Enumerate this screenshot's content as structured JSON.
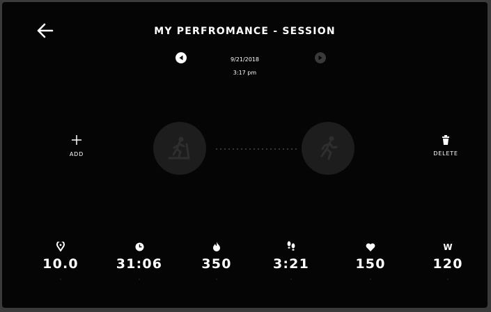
{
  "header": {
    "back_icon": "arrow-left-icon",
    "title": "MY PERFROMANCE - SESSION"
  },
  "session": {
    "date": "9/21/2018",
    "time": "3:17 pm",
    "prev_icon": "chevron-left-circle-icon",
    "next_icon": "chevron-right-circle-icon"
  },
  "actions": {
    "add_label": "ADD",
    "add_icon": "plus-icon",
    "delete_label": "DELETE",
    "delete_icon": "trash-icon"
  },
  "activities": [
    {
      "icon": "treadmill-icon"
    },
    {
      "icon": "running-icon"
    }
  ],
  "stats": [
    {
      "icon": "location-pin-icon",
      "value": "10.0"
    },
    {
      "icon": "clock-icon",
      "value": "31:06"
    },
    {
      "icon": "flame-icon",
      "value": "350"
    },
    {
      "icon": "footprints-icon",
      "value": "3:21"
    },
    {
      "icon": "heart-icon",
      "value": "150"
    },
    {
      "icon": "watts-icon",
      "value": "120",
      "icon_text": "W"
    }
  ],
  "colors": {
    "background": "#050505",
    "text": "#ffffff",
    "inactive_circle": "#1d1d1d",
    "inactive_icon": "#2e2e2e"
  }
}
